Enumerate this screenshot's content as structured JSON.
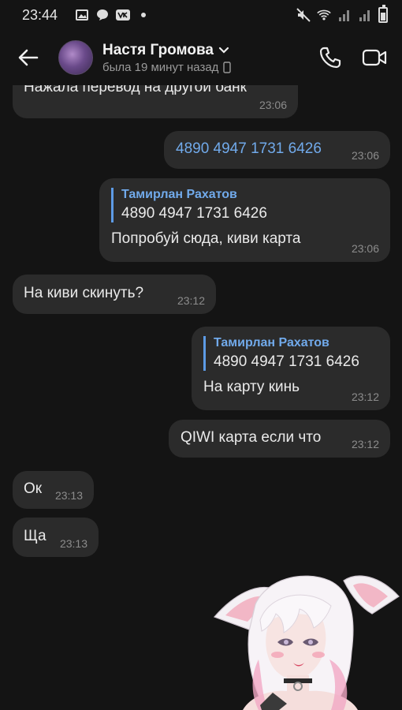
{
  "status_bar": {
    "time": "23:44",
    "left_icons": [
      "gallery-icon",
      "chat-bubble-icon",
      "vk-icon",
      "dot-icon"
    ],
    "right_icons": [
      "mute-icon",
      "wifi-icon",
      "signal-icon",
      "signal-icon",
      "battery-icon"
    ]
  },
  "header": {
    "contact_name": "Настя Громова",
    "contact_status": "была 19 минут назад",
    "actions": [
      "phone-icon",
      "video-icon"
    ]
  },
  "messages": [
    {
      "id": 0,
      "side": "in",
      "text": "Нажала перевод на другой банк",
      "time": "23:06"
    },
    {
      "id": 1,
      "side": "out",
      "text": "4890 4947 1731 6426",
      "time": "23:06",
      "is_link": true
    },
    {
      "id": 2,
      "side": "out",
      "reply_name": "Тамирлан Рахатов",
      "reply_text": "4890 4947 1731 6426",
      "text": "Попробуй сюда, киви карта",
      "time": "23:06"
    },
    {
      "id": 3,
      "side": "in",
      "text": "На киви скинуть?",
      "time": "23:12"
    },
    {
      "id": 4,
      "side": "out",
      "reply_name": "Тамирлан Рахатов",
      "reply_text": "4890 4947 1731 6426",
      "text": "На карту кинь",
      "time": "23:12"
    },
    {
      "id": 5,
      "side": "out",
      "text": "QIWI карта если что",
      "time": "23:12"
    },
    {
      "id": 6,
      "side": "in",
      "text": "Ок",
      "time": "23:13"
    },
    {
      "id": 7,
      "side": "in",
      "text": "Ща",
      "time": "23:13"
    }
  ],
  "sticker": {
    "description_icon": "anime-girl-sticker"
  }
}
